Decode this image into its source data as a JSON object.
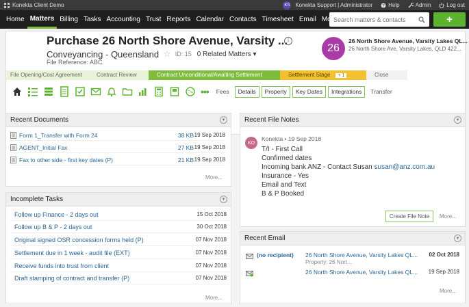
{
  "topbar": {
    "app_name": "Konekta Client Demo",
    "user_initials": "KS",
    "user_label": "Konekta Support | Administrator",
    "help_label": "Help",
    "admin_label": "Admin",
    "logout_label": "Log out"
  },
  "nav": {
    "items": [
      {
        "label": "Home"
      },
      {
        "label": "Matters"
      },
      {
        "label": "Billing"
      },
      {
        "label": "Tasks"
      },
      {
        "label": "Accounting"
      },
      {
        "label": "Trust"
      },
      {
        "label": "Reports"
      },
      {
        "label": "Calendar"
      },
      {
        "label": "Contacts"
      },
      {
        "label": "Timesheet"
      },
      {
        "label": "Email"
      },
      {
        "label": "More..."
      }
    ],
    "search_placeholder": "Search matters & contacts",
    "add_label": "+"
  },
  "matter": {
    "title": "Purchase 26 North Shore Avenue, Varsity ...",
    "info_glyph": "i",
    "subtitle": "Conveyancing - Queensland",
    "star": "☆",
    "id_label": "ID: 15",
    "related": "0 Related Matters ▾",
    "file_ref": "File Reference: ABC",
    "badge_number": "26",
    "client_name": "26 North Shore Avenue, Varsity Lakes QL...",
    "client_address": "26 North Shore Ave, Varsity Lakes, QLD 422..."
  },
  "stages": [
    {
      "label": "File Opening/Cost Agreement"
    },
    {
      "label": "Contract Review"
    },
    {
      "label": "Contract Unconditional/Awaiting Settlement"
    },
    {
      "label": "Settlement Stage",
      "extra": "+ 1"
    },
    {
      "label": "Close"
    }
  ],
  "toolbar": {
    "more_glyph": "•••",
    "tabs": [
      {
        "label": "Fees"
      },
      {
        "label": "Details"
      },
      {
        "label": "Property"
      },
      {
        "label": "Key Dates"
      },
      {
        "label": "Integrations"
      },
      {
        "label": "Transfer"
      }
    ]
  },
  "recent_documents": {
    "title": "Recent Documents",
    "collapse_glyph": "▼",
    "rows": [
      {
        "name": "Form 1_Transfer with Form 24",
        "size": "38 KB",
        "date": "19 Sep 2018"
      },
      {
        "name": "AGENT_Initial Fax",
        "size": "27 KB",
        "date": "19 Sep 2018"
      },
      {
        "name": "Fax to other side - first key dates (P)",
        "size": "21 KB",
        "date": "19 Sep 2018"
      }
    ],
    "more_label": "More..."
  },
  "incomplete_tasks": {
    "title": "Incomplete Tasks",
    "collapse_glyph": "▼",
    "rows": [
      {
        "name": "Follow up Finance - 2 days out",
        "date": "15 Oct 2018"
      },
      {
        "name": "Follow up B & P - 2 days out",
        "date": "30 Oct 2018"
      },
      {
        "name": "Original signed OSR concession forms held (P)",
        "date": "07 Nov 2018"
      },
      {
        "name": "Settlement due in 1 week - audit file (EXT)",
        "date": "07 Nov 2018"
      },
      {
        "name": "Receive funds into trust from client",
        "date": "07 Nov 2018"
      },
      {
        "name": "Draft stamping of contract and transfer (P)",
        "date": "07 Nov 2018"
      }
    ],
    "more_label": "More..."
  },
  "recent_file_notes": {
    "title": "Recent File Notes",
    "collapse_glyph": "▼",
    "avatar": "KO",
    "meta": "Konekta • 19 Sep 2018",
    "lines": [
      "T/I - First Call",
      "Confirmed dates",
      "Incoming bank ANZ - Contact Susan",
      "Insurance - Yes",
      "Email and Text",
      "B & P Booked"
    ],
    "email_link": "susan@anz.com.au",
    "create_button": "Create File Note",
    "more_label": "More..."
  },
  "recent_email": {
    "title": "Recent Email",
    "collapse_glyph": "▼",
    "rows": [
      {
        "recipient": "(no recipient)",
        "subject": "26 North Shore Avenue, Varsity Lakes QL...",
        "property": "Property: 26 Nort...",
        "date": "02 Oct 2018"
      },
      {
        "recipient": "",
        "subject": "26 North Shore Avenue, Varsity Lakes QL...",
        "property": "",
        "date": "19 Sep 2018"
      }
    ],
    "more_label": "More..."
  },
  "colors": {
    "accent_green": "#7dbd3b",
    "nav_bg": "#1f1f1f",
    "badge_purple": "#a93ba8",
    "stage_yellow": "#f3c12f",
    "link_blue": "#2a6496"
  }
}
